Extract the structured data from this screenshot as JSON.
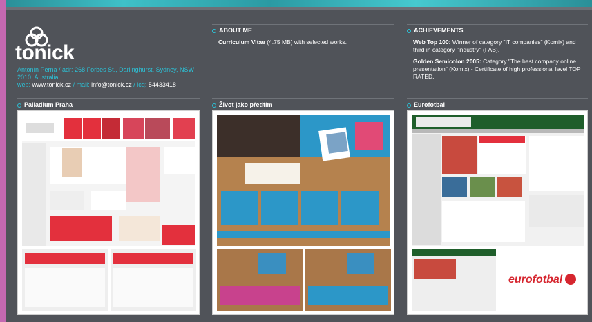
{
  "brand": {
    "logo_text": "tonick"
  },
  "contact": {
    "name_label": "Antonín Perna / adr:",
    "address": "268 Forbes St., Darlinghurst, Sydney, NSW 2010, Australia",
    "web_label": "web:",
    "web": "www.tonick.cz",
    "mail_label": "/ mail:",
    "mail": "info@tonick.cz",
    "icq_label": "/ icq:",
    "icq": "54433418"
  },
  "about": {
    "heading": "ABOUT ME",
    "cv_link": "Curriculum Vitae",
    "cv_size": "(4.75 MB) with selected works."
  },
  "achievements": {
    "heading": "ACHIEVEMENTS",
    "item1_title": "Web Top 100:",
    "item1_text": "Winner of category \"IT companies\" (Komix) and third in category \"industry\" (FAB).",
    "item2_title": "Golden Semicolon 2005:",
    "item2_text": "Category \"The best company online presentation\" (Komix) - Certificate of high professional level TOP RATED."
  },
  "portfolio": [
    {
      "heading": "Palladium Praha"
    },
    {
      "heading": "Život jako předtím"
    },
    {
      "heading": "Eurofotbal"
    }
  ],
  "colors": {
    "accent": "#2cc1d6",
    "background": "#505359",
    "frame": "#c568b1"
  }
}
